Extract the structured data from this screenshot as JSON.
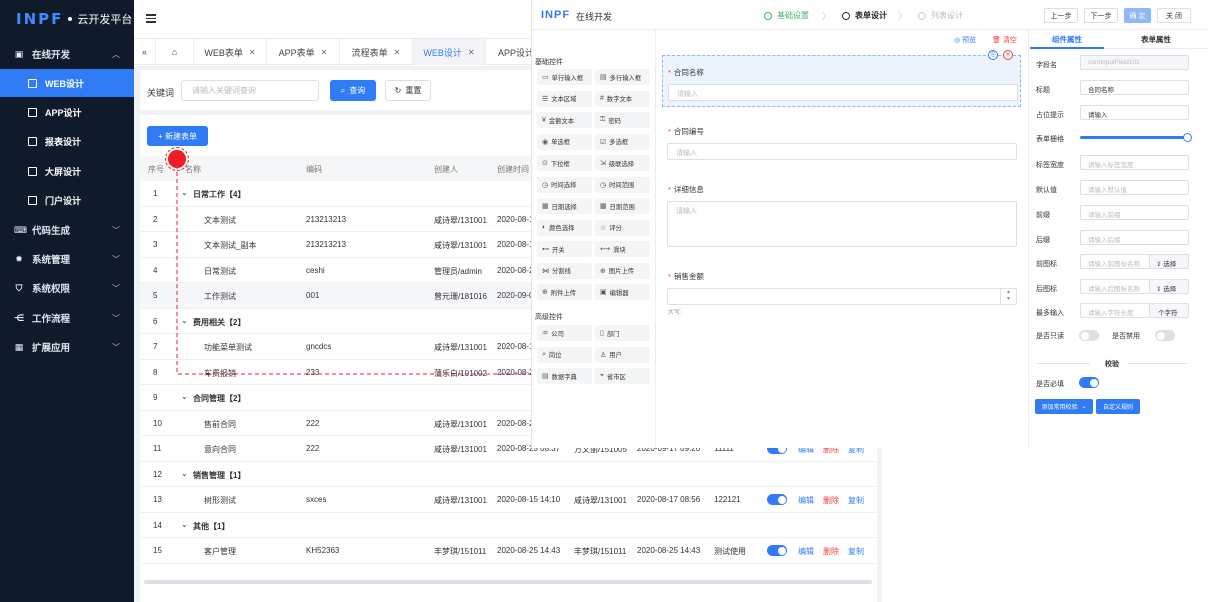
{
  "app": {
    "logo": "INPF",
    "title": "云开发平台"
  },
  "sidebar": {
    "group_online": "在线开发",
    "sub": [
      {
        "label": "WEB设计"
      },
      {
        "label": "APP设计"
      },
      {
        "label": "报表设计"
      },
      {
        "label": "大屏设计"
      },
      {
        "label": "门户设计"
      }
    ],
    "groups": [
      {
        "label": "代码生成"
      },
      {
        "label": "系统管理"
      },
      {
        "label": "系统权限"
      },
      {
        "label": "工作流程"
      },
      {
        "label": "扩展应用"
      }
    ]
  },
  "tabs": [
    {
      "label": "WEB表单"
    },
    {
      "label": "APP表单"
    },
    {
      "label": "流程表单"
    },
    {
      "label": "WEB设计"
    },
    {
      "label": "APP设计"
    }
  ],
  "search": {
    "label": "关键词",
    "placeholder": "请输入关键词查询",
    "query_label": "查询",
    "reset_label": "重置"
  },
  "new_form_label": "+ 新建表单",
  "table": {
    "headers": [
      "序号",
      "名称",
      "编码",
      "创建人",
      "创建时间"
    ],
    "rows": [
      {
        "no": "1",
        "name": "日常工作【4】",
        "group": true
      },
      {
        "no": "2",
        "name": "文本测试",
        "code": "213213213",
        "creator": "咸诗翠/131001",
        "time": "2020-08-1"
      },
      {
        "no": "3",
        "name": "文本测试_副本",
        "code": "213213213",
        "creator": "咸诗翠/131001",
        "time": "2020-08-1"
      },
      {
        "no": "4",
        "name": "日常测试",
        "code": "ceshi",
        "creator": "管理员/admin",
        "time": "2020-08-2"
      },
      {
        "no": "5",
        "name": "工作测试",
        "code": "001",
        "creator": "曾元珊/181016",
        "time": "2020-09-0"
      },
      {
        "no": "6",
        "name": "费用相关【2】",
        "group": true
      },
      {
        "no": "7",
        "name": "功能菜单测试",
        "code": "gncdcs",
        "creator": "咸诗翠/131001",
        "time": "2020-08-1"
      },
      {
        "no": "8",
        "name": "车费报销",
        "code": "233",
        "creator": "蒲乐白/101002",
        "time": "2020-08-2"
      },
      {
        "no": "9",
        "name": "合同管理【2】",
        "group": true
      },
      {
        "no": "10",
        "name": "售前合同",
        "code": "222",
        "creator": "咸诗翠/131001",
        "time": "2020-08-2"
      },
      {
        "no": "11",
        "name": "意向合同",
        "code": "222",
        "creator": "咸诗翠/131001",
        "time": "2020-08-25 08:37",
        "editor": "方文丽/151005",
        "edit_time": "2020-09-17 09:20",
        "remark": "11111",
        "actions": true
      },
      {
        "no": "12",
        "name": "销售管理【1】",
        "group": true
      },
      {
        "no": "13",
        "name": "树形测试",
        "code": "sxces",
        "creator": "咸诗翠/131001",
        "time": "2020-08-15 14:10",
        "editor": "咸诗翠/131001",
        "edit_time": "2020-08-17 08:56",
        "remark": "122121",
        "actions": true
      },
      {
        "no": "14",
        "name": "其他【1】",
        "group": true
      },
      {
        "no": "15",
        "name": "客户管理",
        "code": "KH52363",
        "creator": "丰梦琪/151011",
        "time": "2020-08-25 14:43",
        "editor": "丰梦琪/151011",
        "edit_time": "2020-08-25 14:43",
        "remark": "测试使用",
        "actions": true
      }
    ],
    "action_labels": {
      "edit": "编辑",
      "delete": "删除",
      "copy": "复制"
    }
  },
  "designer": {
    "logo": "INPF",
    "title": "在线开发",
    "steps": [
      {
        "label": "基础设置"
      },
      {
        "label": "表单设计"
      },
      {
        "label": "列表设计"
      }
    ],
    "buttons": {
      "prev": "上一步",
      "next": "下一步",
      "confirm": "确 定",
      "close": "关 闭"
    },
    "palette_basic_title": "基础控件",
    "palette_basic": [
      {
        "icon": "▭",
        "label": "单行输入框"
      },
      {
        "icon": "▤",
        "label": "多行输入框"
      },
      {
        "icon": "☰",
        "label": "文本区域"
      },
      {
        "icon": "#",
        "label": "数字文本"
      },
      {
        "icon": "¥",
        "label": "金额文本"
      },
      {
        "icon": "⚿",
        "label": "密码"
      },
      {
        "icon": "◉",
        "label": "单选框"
      },
      {
        "icon": "☑",
        "label": "多选框"
      },
      {
        "icon": "⊙",
        "label": "下拉框"
      },
      {
        "icon": "⇲",
        "label": "级联选择"
      },
      {
        "icon": "◷",
        "label": "时间选择"
      },
      {
        "icon": "◷",
        "label": "时间范围"
      },
      {
        "icon": "▦",
        "label": "日期选择"
      },
      {
        "icon": "▦",
        "label": "日期范围"
      },
      {
        "icon": "◐",
        "label": "颜色选择"
      },
      {
        "icon": "☆",
        "label": "评分"
      },
      {
        "icon": "⊷",
        "label": "开关"
      },
      {
        "icon": "⟷",
        "label": "滑块"
      },
      {
        "icon": "⋈",
        "label": "分割线"
      },
      {
        "icon": "⊕",
        "label": "图片上传"
      },
      {
        "icon": "⊕",
        "label": "附件上传"
      },
      {
        "icon": "▣",
        "label": "编辑器"
      }
    ],
    "palette_advanced_title": "高级控件",
    "palette_advanced": [
      {
        "icon": "♒",
        "label": "公司"
      },
      {
        "icon": "▯",
        "label": "部门"
      },
      {
        "icon": "⌕",
        "label": "岗位"
      },
      {
        "icon": "♙",
        "label": "用户"
      },
      {
        "icon": "▤",
        "label": "数据字典"
      },
      {
        "icon": "⌖",
        "label": "省市区"
      }
    ],
    "canvas_actions": {
      "preview": "预览",
      "clear": "清空"
    },
    "fields": [
      {
        "label": "合同名称",
        "placeholder": "请输入"
      },
      {
        "label": "合同编号",
        "placeholder": "请输入"
      },
      {
        "label": "详细信息",
        "placeholder": "请输入"
      },
      {
        "label": "销售金额",
        "placeholder": "",
        "hint": "大写:"
      }
    ],
    "prop_tabs": {
      "component": "组件属性",
      "form": "表单属性"
    },
    "props": {
      "field_name": {
        "label": "字段名",
        "value": "comInputField101"
      },
      "title": {
        "label": "标题",
        "value": "合同名称"
      },
      "placeholder": {
        "label": "占位提示",
        "value": "请输入"
      },
      "grid": {
        "label": "表单栅格",
        "value": 24
      },
      "label_width": {
        "label": "标签宽度",
        "placeholder": "请输入标签宽度"
      },
      "default": {
        "label": "默认值",
        "placeholder": "请输入默认值"
      },
      "prefix": {
        "label": "前缀",
        "placeholder": "请输入前缀"
      },
      "suffix": {
        "label": "后缀",
        "placeholder": "请输入后缀"
      },
      "prefix_icon": {
        "label": "前图标",
        "placeholder": "请输入前图标名称",
        "btn": "选择"
      },
      "suffix_icon": {
        "label": "后图标",
        "placeholder": "请输入后图标名称",
        "btn": "选择"
      },
      "maxlen": {
        "label": "最多输入",
        "placeholder": "请输入字符长度",
        "unit": "个字符"
      },
      "readonly": {
        "label": "是否只读"
      },
      "disabled": {
        "label": "是否禁用"
      },
      "validate_title": "校验",
      "required": {
        "label": "是否必填"
      },
      "add_rule": "添加常用校验",
      "custom_rule": "自定义规则"
    }
  },
  "colors": {
    "primary": "#2f7cf6",
    "sidebar": "#0f1a2b",
    "danger": "#f04040",
    "success": "#42b86b"
  }
}
